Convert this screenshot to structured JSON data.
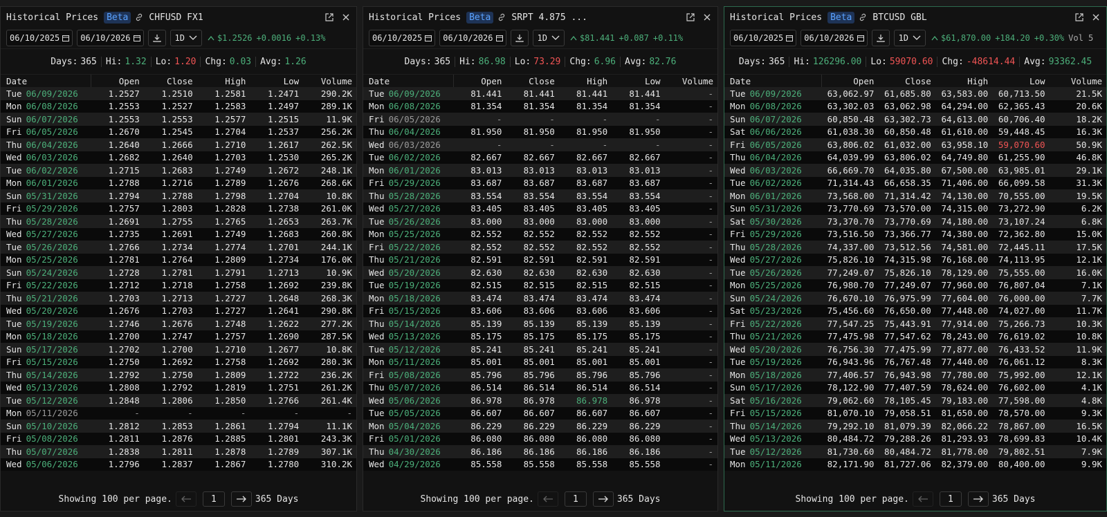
{
  "panels": [
    {
      "title": "Historical Prices",
      "badge": "Beta",
      "symbol": "CHFUSD FX1",
      "start_date": "06/10/2025",
      "end_date": "06/10/2026",
      "interval": "1D",
      "quote": {
        "last": "$1.2526",
        "change": "+0.0016",
        "pct": "+0.13%"
      },
      "stats": {
        "days_label": "Days:",
        "days": "365",
        "hi_label": "Hi:",
        "hi": "1.32",
        "lo_label": "Lo:",
        "lo": "1.20",
        "chg_label": "Chg:",
        "chg": "0.03",
        "avg_label": "Avg:",
        "avg": "1.26"
      },
      "columns": [
        "Date",
        "Open",
        "Close",
        "High",
        "Low",
        "Volume"
      ],
      "rows": [
        [
          "Tue",
          "06/09/2026",
          "1.2527",
          "1.2510",
          "1.2581",
          "1.2471",
          "290.2K"
        ],
        [
          "Mon",
          "06/08/2026",
          "1.2553",
          "1.2527",
          "1.2583",
          "1.2497",
          "289.1K"
        ],
        [
          "Sun",
          "06/07/2026",
          "1.2553",
          "1.2553",
          "1.2577",
          "1.2515",
          "11.9K"
        ],
        [
          "Fri",
          "06/05/2026",
          "1.2670",
          "1.2545",
          "1.2704",
          "1.2537",
          "256.2K"
        ],
        [
          "Thu",
          "06/04/2026",
          "1.2640",
          "1.2666",
          "1.2710",
          "1.2617",
          "262.5K"
        ],
        [
          "Wed",
          "06/03/2026",
          "1.2682",
          "1.2640",
          "1.2703",
          "1.2530",
          "265.2K"
        ],
        [
          "Tue",
          "06/02/2026",
          "1.2715",
          "1.2683",
          "1.2749",
          "1.2672",
          "248.1K"
        ],
        [
          "Mon",
          "06/01/2026",
          "1.2788",
          "1.2716",
          "1.2789",
          "1.2676",
          "268.6K"
        ],
        [
          "Sun",
          "05/31/2026",
          "1.2794",
          "1.2788",
          "1.2798",
          "1.2704",
          "10.8K"
        ],
        [
          "Fri",
          "05/29/2026",
          "1.2757",
          "1.2803",
          "1.2828",
          "1.2738",
          "261.0K"
        ],
        [
          "Thu",
          "05/28/2026",
          "1.2691",
          "1.2755",
          "1.2765",
          "1.2653",
          "263.7K"
        ],
        [
          "Wed",
          "05/27/2026",
          "1.2735",
          "1.2691",
          "1.2749",
          "1.2683",
          "260.8K"
        ],
        [
          "Tue",
          "05/26/2026",
          "1.2766",
          "1.2734",
          "1.2774",
          "1.2701",
          "244.1K"
        ],
        [
          "Mon",
          "05/25/2026",
          "1.2781",
          "1.2764",
          "1.2809",
          "1.2734",
          "176.0K"
        ],
        [
          "Sun",
          "05/24/2026",
          "1.2728",
          "1.2781",
          "1.2791",
          "1.2713",
          "10.9K"
        ],
        [
          "Fri",
          "05/22/2026",
          "1.2712",
          "1.2718",
          "1.2758",
          "1.2692",
          "239.8K"
        ],
        [
          "Thu",
          "05/21/2026",
          "1.2703",
          "1.2713",
          "1.2727",
          "1.2648",
          "268.3K"
        ],
        [
          "Wed",
          "05/20/2026",
          "1.2676",
          "1.2703",
          "1.2727",
          "1.2641",
          "290.8K"
        ],
        [
          "Tue",
          "05/19/2026",
          "1.2746",
          "1.2676",
          "1.2748",
          "1.2622",
          "277.2K"
        ],
        [
          "Mon",
          "05/18/2026",
          "1.2700",
          "1.2747",
          "1.2757",
          "1.2690",
          "287.5K"
        ],
        [
          "Sun",
          "05/17/2026",
          "1.2702",
          "1.2700",
          "1.2710",
          "1.2677",
          "10.8K"
        ],
        [
          "Fri",
          "05/15/2026",
          "1.2750",
          "1.2692",
          "1.2758",
          "1.2692",
          "280.3K"
        ],
        [
          "Thu",
          "05/14/2026",
          "1.2792",
          "1.2750",
          "1.2809",
          "1.2722",
          "236.2K"
        ],
        [
          "Wed",
          "05/13/2026",
          "1.2808",
          "1.2792",
          "1.2819",
          "1.2751",
          "261.2K"
        ],
        [
          "Tue",
          "05/12/2026",
          "1.2848",
          "1.2806",
          "1.2850",
          "1.2766",
          "261.4K"
        ],
        [
          "Mon",
          "05/11/2026",
          "-",
          "-",
          "-",
          "-",
          "-"
        ],
        [
          "Sun",
          "05/10/2026",
          "1.2812",
          "1.2853",
          "1.2861",
          "1.2794",
          "11.1K"
        ],
        [
          "Fri",
          "05/08/2026",
          "1.2811",
          "1.2876",
          "1.2885",
          "1.2801",
          "243.3K"
        ],
        [
          "Thu",
          "05/07/2026",
          "1.2838",
          "1.2811",
          "1.2878",
          "1.2789",
          "307.1K"
        ],
        [
          "Wed",
          "05/06/2026",
          "1.2796",
          "1.2837",
          "1.2867",
          "1.2780",
          "310.2K"
        ]
      ],
      "footer": {
        "showing": "Showing 100 per page.",
        "page": "1",
        "days": "365 Days"
      }
    },
    {
      "title": "Historical Prices",
      "badge": "Beta",
      "symbol": "SRPT 4.875 ...",
      "start_date": "06/10/2025",
      "end_date": "06/10/2026",
      "interval": "1D",
      "quote": {
        "last": "$81.441",
        "change": "+0.087",
        "pct": "+0.11%"
      },
      "stats": {
        "days_label": "Days:",
        "days": "365",
        "hi_label": "Hi:",
        "hi": "86.98",
        "lo_label": "Lo:",
        "lo": "73.29",
        "chg_label": "Chg:",
        "chg": "6.96",
        "avg_label": "Avg:",
        "avg": "82.76"
      },
      "columns": [
        "Date",
        "Open",
        "Close",
        "High",
        "Low",
        "Volume"
      ],
      "rows": [
        [
          "Tue",
          "06/09/2026",
          "81.441",
          "81.441",
          "81.441",
          "81.441",
          "-"
        ],
        [
          "Mon",
          "06/08/2026",
          "81.354",
          "81.354",
          "81.354",
          "81.354",
          "-"
        ],
        [
          "Fri",
          "06/05/2026",
          "-",
          "-",
          "-",
          "-",
          "-"
        ],
        [
          "Thu",
          "06/04/2026",
          "81.950",
          "81.950",
          "81.950",
          "81.950",
          "-"
        ],
        [
          "Wed",
          "06/03/2026",
          "-",
          "-",
          "-",
          "-",
          "-"
        ],
        [
          "Tue",
          "06/02/2026",
          "82.667",
          "82.667",
          "82.667",
          "82.667",
          "-"
        ],
        [
          "Mon",
          "06/01/2026",
          "83.013",
          "83.013",
          "83.013",
          "83.013",
          "-"
        ],
        [
          "Fri",
          "05/29/2026",
          "83.687",
          "83.687",
          "83.687",
          "83.687",
          "-"
        ],
        [
          "Thu",
          "05/28/2026",
          "83.554",
          "83.554",
          "83.554",
          "83.554",
          "-"
        ],
        [
          "Wed",
          "05/27/2026",
          "83.405",
          "83.405",
          "83.405",
          "83.405",
          "-"
        ],
        [
          "Tue",
          "05/26/2026",
          "83.000",
          "83.000",
          "83.000",
          "83.000",
          "-"
        ],
        [
          "Mon",
          "05/25/2026",
          "82.552",
          "82.552",
          "82.552",
          "82.552",
          "-"
        ],
        [
          "Fri",
          "05/22/2026",
          "82.552",
          "82.552",
          "82.552",
          "82.552",
          "-"
        ],
        [
          "Thu",
          "05/21/2026",
          "82.591",
          "82.591",
          "82.591",
          "82.591",
          "-"
        ],
        [
          "Wed",
          "05/20/2026",
          "82.630",
          "82.630",
          "82.630",
          "82.630",
          "-"
        ],
        [
          "Tue",
          "05/19/2026",
          "82.515",
          "82.515",
          "82.515",
          "82.515",
          "-"
        ],
        [
          "Mon",
          "05/18/2026",
          "83.474",
          "83.474",
          "83.474",
          "83.474",
          "-"
        ],
        [
          "Fri",
          "05/15/2026",
          "83.606",
          "83.606",
          "83.606",
          "83.606",
          "-"
        ],
        [
          "Thu",
          "05/14/2026",
          "85.139",
          "85.139",
          "85.139",
          "85.139",
          "-"
        ],
        [
          "Wed",
          "05/13/2026",
          "85.175",
          "85.175",
          "85.175",
          "85.175",
          "-"
        ],
        [
          "Tue",
          "05/12/2026",
          "85.241",
          "85.241",
          "85.241",
          "85.241",
          "-"
        ],
        [
          "Mon",
          "05/11/2026",
          "85.001",
          "85.001",
          "85.001",
          "85.001",
          "-"
        ],
        [
          "Fri",
          "05/08/2026",
          "85.796",
          "85.796",
          "85.796",
          "85.796",
          "-"
        ],
        [
          "Thu",
          "05/07/2026",
          "86.514",
          "86.514",
          "86.514",
          "86.514",
          "-"
        ],
        [
          "Wed",
          "05/06/2026",
          "86.978",
          "86.978",
          "86.978",
          "86.978",
          "-"
        ],
        [
          "Tue",
          "05/05/2026",
          "86.607",
          "86.607",
          "86.607",
          "86.607",
          "-"
        ],
        [
          "Mon",
          "05/04/2026",
          "86.229",
          "86.229",
          "86.229",
          "86.229",
          "-"
        ],
        [
          "Fri",
          "05/01/2026",
          "86.080",
          "86.080",
          "86.080",
          "86.080",
          "-"
        ],
        [
          "Thu",
          "04/30/2026",
          "86.186",
          "86.186",
          "86.186",
          "86.186",
          "-"
        ],
        [
          "Wed",
          "04/29/2026",
          "85.558",
          "85.558",
          "85.558",
          "85.558",
          "-"
        ]
      ],
      "footer": {
        "showing": "Showing 100 per page.",
        "page": "1",
        "days": "365 Days"
      }
    },
    {
      "title": "Historical Prices",
      "badge": "Beta",
      "symbol": "BTCUSD GBL",
      "start_date": "06/10/2025",
      "end_date": "06/10/2026",
      "interval": "1D",
      "quote": {
        "last": "$61,870.00",
        "change": "+184.20",
        "pct": "+0.30%",
        "vol": "Vol 5"
      },
      "stats": {
        "days_label": "Days:",
        "days": "365",
        "hi_label": "Hi:",
        "hi": "126296.00",
        "lo_label": "Lo:",
        "lo": "59070.60",
        "chg_label": "Chg:",
        "chg": "-48614.44",
        "avg_label": "Avg:",
        "avg": "93362.45"
      },
      "columns": [
        "Date",
        "Open",
        "Close",
        "High",
        "Low",
        "Volume"
      ],
      "rows": [
        [
          "Tue",
          "06/09/2026",
          "63,062.97",
          "61,685.80",
          "63,583.00",
          "60,713.50",
          "21.5K"
        ],
        [
          "Mon",
          "06/08/2026",
          "63,302.03",
          "63,062.98",
          "64,294.00",
          "62,365.43",
          "20.6K"
        ],
        [
          "Sun",
          "06/07/2026",
          "60,850.48",
          "63,302.73",
          "64,613.00",
          "60,706.40",
          "18.2K"
        ],
        [
          "Sat",
          "06/06/2026",
          "61,038.30",
          "60,850.48",
          "61,610.00",
          "59,448.45",
          "16.3K"
        ],
        [
          "Fri",
          "06/05/2026",
          "63,806.02",
          "61,032.00",
          "63,958.10",
          "59,070.60",
          "50.9K"
        ],
        [
          "Thu",
          "06/04/2026",
          "64,039.99",
          "63,806.02",
          "64,749.80",
          "61,255.90",
          "46.8K"
        ],
        [
          "Wed",
          "06/03/2026",
          "66,669.70",
          "64,035.80",
          "67,500.00",
          "63,985.01",
          "29.1K"
        ],
        [
          "Tue",
          "06/02/2026",
          "71,314.43",
          "66,658.35",
          "71,406.00",
          "66,099.58",
          "31.3K"
        ],
        [
          "Mon",
          "06/01/2026",
          "73,568.00",
          "71,314.42",
          "74,130.00",
          "70,555.00",
          "19.5K"
        ],
        [
          "Sun",
          "05/31/2026",
          "73,770.69",
          "73,570.00",
          "74,315.00",
          "73,272.90",
          "6.2K"
        ],
        [
          "Sat",
          "05/30/2026",
          "73,370.70",
          "73,770.69",
          "74,180.00",
          "73,107.24",
          "6.8K"
        ],
        [
          "Fri",
          "05/29/2026",
          "73,516.50",
          "73,366.77",
          "74,380.00",
          "72,362.80",
          "15.0K"
        ],
        [
          "Thu",
          "05/28/2026",
          "74,337.00",
          "73,512.56",
          "74,581.00",
          "72,445.11",
          "17.5K"
        ],
        [
          "Wed",
          "05/27/2026",
          "75,826.10",
          "74,315.98",
          "76,168.00",
          "74,113.95",
          "12.1K"
        ],
        [
          "Tue",
          "05/26/2026",
          "77,249.07",
          "75,826.10",
          "78,129.00",
          "75,555.00",
          "16.0K"
        ],
        [
          "Mon",
          "05/25/2026",
          "76,980.70",
          "77,249.07",
          "77,960.00",
          "76,807.04",
          "7.1K"
        ],
        [
          "Sun",
          "05/24/2026",
          "76,670.10",
          "76,975.99",
          "77,604.00",
          "76,000.00",
          "7.7K"
        ],
        [
          "Sat",
          "05/23/2026",
          "75,456.60",
          "76,650.00",
          "77,448.00",
          "74,027.00",
          "11.7K"
        ],
        [
          "Fri",
          "05/22/2026",
          "77,547.25",
          "75,443.91",
          "77,914.00",
          "75,266.73",
          "10.3K"
        ],
        [
          "Thu",
          "05/21/2026",
          "77,475.98",
          "77,547.62",
          "78,243.00",
          "76,619.02",
          "10.8K"
        ],
        [
          "Wed",
          "05/20/2026",
          "76,756.30",
          "77,475.99",
          "77,877.00",
          "76,433.52",
          "11.9K"
        ],
        [
          "Tue",
          "05/19/2026",
          "76,943.96",
          "76,767.48",
          "77,440.00",
          "76,061.12",
          "8.3K"
        ],
        [
          "Mon",
          "05/18/2026",
          "77,406.57",
          "76,943.98",
          "77,780.00",
          "75,992.00",
          "12.1K"
        ],
        [
          "Sun",
          "05/17/2026",
          "78,122.90",
          "77,407.59",
          "78,624.00",
          "76,602.00",
          "4.1K"
        ],
        [
          "Sat",
          "05/16/2026",
          "79,062.60",
          "78,105.45",
          "79,183.00",
          "77,598.00",
          "4.8K"
        ],
        [
          "Fri",
          "05/15/2026",
          "81,070.10",
          "79,058.51",
          "81,650.00",
          "78,570.00",
          "9.3K"
        ],
        [
          "Thu",
          "05/14/2026",
          "79,292.10",
          "81,079.39",
          "82,066.22",
          "78,867.00",
          "16.5K"
        ],
        [
          "Wed",
          "05/13/2026",
          "80,484.72",
          "79,288.26",
          "81,293.93",
          "78,699.83",
          "10.4K"
        ],
        [
          "Tue",
          "05/12/2026",
          "81,730.60",
          "80,484.72",
          "81,778.00",
          "79,802.51",
          "7.9K"
        ],
        [
          "Mon",
          "05/11/2026",
          "82,171.90",
          "81,727.06",
          "82,379.00",
          "80,400.00",
          "9.9K"
        ]
      ],
      "footer": {
        "showing": "Showing 100 per page.",
        "page": "1",
        "days": "365 Days"
      }
    }
  ],
  "colors": {
    "positive": "#4caf7a",
    "negative": "#f05454",
    "badge_bg": "#1e3356",
    "badge_fg": "#5aa2ff",
    "panel_bg": "#121212"
  },
  "icons": [
    "link-icon",
    "external-link-icon",
    "close-icon",
    "calendar-icon",
    "download-icon",
    "chevron-down-icon",
    "trend-up-icon",
    "arrow-left-icon",
    "arrow-right-icon"
  ]
}
